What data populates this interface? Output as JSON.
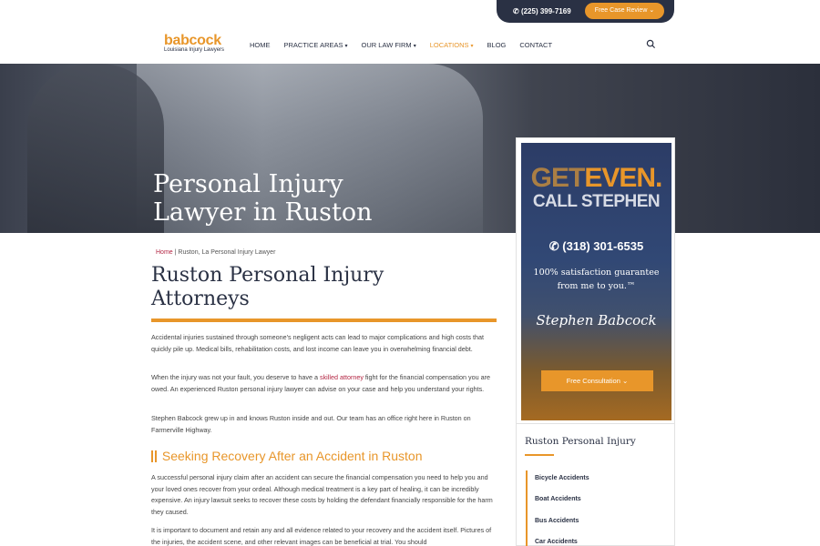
{
  "topbar": {
    "phone": "(225) 399-7169",
    "review_button": "Free Case Review"
  },
  "header": {
    "logo_main": "babcock",
    "logo_sub": "Louisiana Injury Lawyers",
    "nav": [
      {
        "label": "HOME",
        "dropdown": false
      },
      {
        "label": "PRACTICE AREAS",
        "dropdown": true
      },
      {
        "label": "OUR LAW FIRM",
        "dropdown": true
      },
      {
        "label": "LOCATIONS",
        "dropdown": true,
        "active": true
      },
      {
        "label": "BLOG",
        "dropdown": false
      },
      {
        "label": "CONTACT",
        "dropdown": false
      }
    ]
  },
  "hero": {
    "title_line1": "Personal Injury",
    "title_line2": "Lawyer in Ruston"
  },
  "breadcrumb": {
    "home": "Home",
    "separator": " | ",
    "current": "Ruston, La Personal Injury Lawyer"
  },
  "main": {
    "title_line1": "Ruston Personal Injury",
    "title_line2": "Attorneys",
    "p1": "Accidental injuries sustained through someone's negligent acts can lead to major complications and high costs that quickly pile up. Medical bills, rehabilitation costs, and lost income can leave you in overwhelming financial debt.",
    "p2_before": "When the injury was not your fault, you deserve to have a ",
    "p2_link": "skilled attorney",
    "p2_after": " fight for the financial compensation you are owed. An experienced Ruston personal injury lawyer can advise on your case and help you understand your rights.",
    "p3": "Stephen Babcock grew up in and knows Ruston inside and out. Our team has an office right here in Ruston on Farmerville Highway.",
    "section_title": "Seeking Recovery After an Accident in Ruston",
    "p4": "A successful personal injury claim after an accident can secure the financial compensation you need to help you and your loved ones recover from your ordeal. Although medical treatment is a key part of healing, it can be incredibly expensive. An injury lawsuit seeks to recover these costs by holding the defendant financially responsible for the harm they caused.",
    "p5": "It is important to document and retain any and all evidence related to your recovery and the accident itself. Pictures of the injuries, the accident scene, and other relevant images can be beneficial at trial. You should"
  },
  "promo": {
    "get": "GET",
    "even": "EVEN.",
    "call": "CALL STEPHEN",
    "phone": "(318) 301-6535",
    "guarantee": "100% satisfaction guarantee from me to you.™",
    "signature": "Stephen Babcock",
    "button": "Free Consultation"
  },
  "sidebar": {
    "heading": "Ruston Personal Injury",
    "items": [
      "Bicycle Accidents",
      "Boat Accidents",
      "Bus Accidents",
      "Car Accidents"
    ]
  },
  "colors": {
    "accent": "#e8962a",
    "navy": "#2a3144",
    "link": "#b32643"
  }
}
